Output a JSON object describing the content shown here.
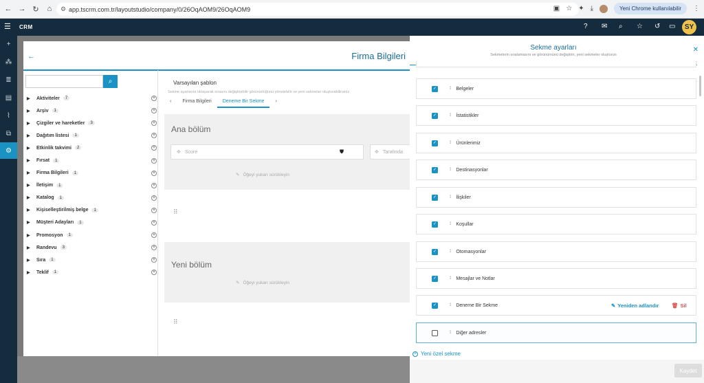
{
  "browser": {
    "url": "app.tscrm.com.tr/layoutstudio/company/0/26OqAOM9/26OqAOM9",
    "chrome_prompt": "Yeni Chrome kullanılabilir"
  },
  "app": {
    "logo": "CRM",
    "user_initials": "SY"
  },
  "page": {
    "title": "Firma Bilgileri",
    "template_label": "Varsayılan şablon",
    "template_note": "Sekme ayarlarını tıklayarak sırasını değiştirebilir görünürlüğünü yönetebilir ve yeni sekmeler oluşturabilirsiniz",
    "tabs": [
      "Firma Bilgileri",
      "Deneme Bir Sekme"
    ]
  },
  "tree": [
    {
      "label": "Aktiviteler",
      "count": "7"
    },
    {
      "label": "Arşiv",
      "count": "1"
    },
    {
      "label": "Çizgiler ve hareketler",
      "count": "3"
    },
    {
      "label": "Dağıtım listesi",
      "count": "1"
    },
    {
      "label": "Etkinlik takvimi",
      "count": "2"
    },
    {
      "label": "Fırsat",
      "count": "1"
    },
    {
      "label": "Firma Bilgileri",
      "count": "1"
    },
    {
      "label": "İletişim",
      "count": "1"
    },
    {
      "label": "Katalog",
      "count": "1"
    },
    {
      "label": "Kişiselleştirilmiş belge",
      "count": "1"
    },
    {
      "label": "Müşteri Adayları",
      "count": "1"
    },
    {
      "label": "Promosyon",
      "count": "1"
    },
    {
      "label": "Randevu",
      "count": "3"
    },
    {
      "label": "Sıra",
      "count": "1"
    },
    {
      "label": "Teklif",
      "count": "1"
    }
  ],
  "sections": {
    "main_title": "Ana bölüm",
    "field_score": "Score",
    "field_partial": "Tarafında",
    "drop_hint": "Öğeyi yukarı sürükleyin",
    "new_title": "Yeni bölüm"
  },
  "panel": {
    "title": "Sekme ayarları",
    "subtitle": "Sekmelerin sıralamasını ve görünümünü değiştirin, yeni sekmeler oluşturun",
    "rows": [
      {
        "label": "Belgeler",
        "checked": true
      },
      {
        "label": "İstatistikler",
        "checked": true
      },
      {
        "label": "Ürünlerimiz",
        "checked": true
      },
      {
        "label": "Destinasyonlar",
        "checked": true
      },
      {
        "label": "İlişkiler",
        "checked": true
      },
      {
        "label": "Koşullar",
        "checked": true
      },
      {
        "label": "Otomasyonlar",
        "checked": true
      },
      {
        "label": "Mesajlar ve Notlar",
        "checked": true
      },
      {
        "label": "Deneme Bir Sekme",
        "checked": true
      },
      {
        "label": "Diğer adresler",
        "checked": false
      }
    ],
    "rename_label": "Yeniden adlandır",
    "delete_label": "Sil",
    "new_tab_label": "Yeni özel sekme",
    "save_label": "Kaydet"
  },
  "colors": {
    "accent": "#1a93c4",
    "nav_bg": "#142c3e",
    "delete": "#d9534f"
  }
}
